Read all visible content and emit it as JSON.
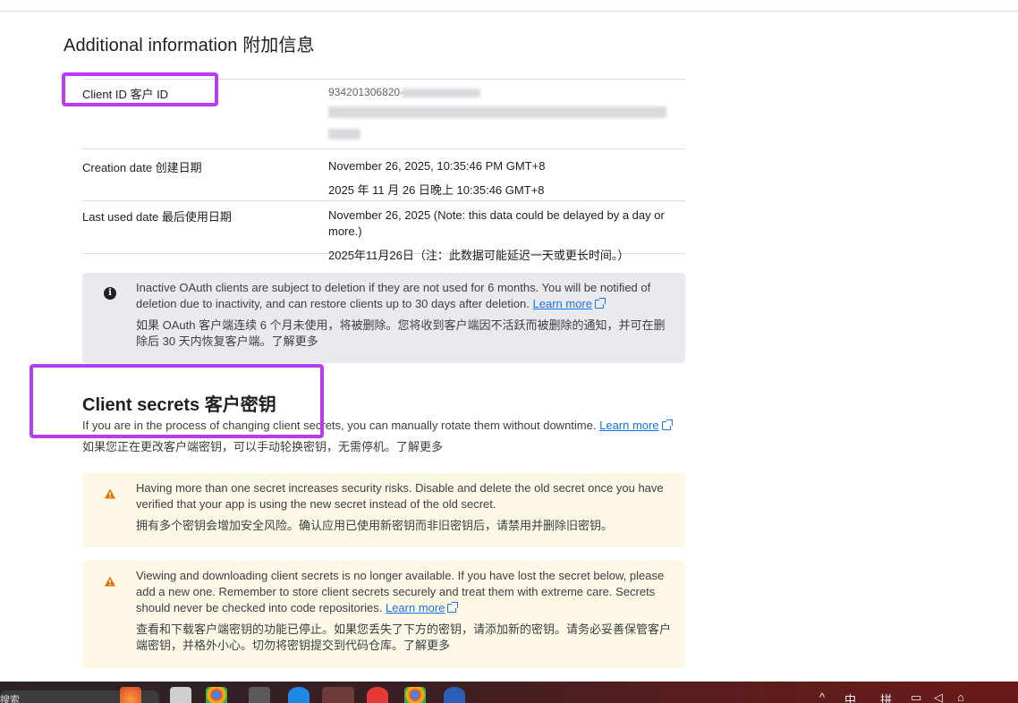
{
  "section_title": "Additional information  附加信息",
  "info_rows": {
    "client_id": {
      "label": "Client ID  客户 ID",
      "value_prefix": "934201306820-"
    },
    "creation_date": {
      "label": "Creation date  创建日期",
      "value_en": "November 26, 2025, 10:35:46 PM GMT+8",
      "value_zh": "2025 年 11 月 26 日晚上 10:35:46 GMT+8"
    },
    "last_used_date": {
      "label": "Last used date  最后使用日期",
      "value_en": "November 26, 2025 (Note: this data could be delayed by a day or more.)",
      "value_zh": "2025年11月26日（注：此数据可能延迟一天或更长时间。）"
    }
  },
  "inactive_notice": {
    "icon": "info-icon",
    "text_en": "Inactive OAuth clients are subject to deletion if they are not used for 6 months. You will be notified of deletion due to inactivity, and can restore clients up to 30 days after deletion.",
    "link": "Learn more",
    "text_zh": "如果 OAuth 客户端连续 6 个月未使用，将被删除。您将收到客户端因不活跃而被删除的通知，并可在删除后 30 天内恢复客户端。了解更多"
  },
  "client_secrets": {
    "title": "Client secrets  客户密钥",
    "desc_en": "If you are in the process of changing client secrets, you can manually rotate them without downtime.",
    "link": "Learn more",
    "desc_zh": "如果您正在更改客户端密钥，可以手动轮换密钥，无需停机。了解更多"
  },
  "warning_multiple": {
    "icon": "warning-icon",
    "text_en": "Having more than one secret increases security risks. Disable and delete the old secret once you have verified that your app is using the new secret instead of the old secret.",
    "text_zh": "拥有多个密钥会增加安全风险。确认应用已使用新密钥而非旧密钥后，请禁用并删除旧密钥。"
  },
  "warning_download": {
    "icon": "warning-icon",
    "text_en": "Viewing and downloading client secrets is no longer available. If you have lost the secret below, please add a new one. Remember to store client secrets securely and treat them with extreme care. Secrets should never be checked into code repositories.",
    "link": "Learn more",
    "text_zh": "查看和下载客户端密钥的功能已停止。如果您丢失了下方的密钥，请添加新的密钥。请务必妥善保管客户端密钥，并格外小心。切勿将密钥提交到代码仓库。了解更多"
  },
  "taskbar": {
    "search_label": "搜索",
    "tray": [
      "^",
      "中",
      "拼"
    ]
  },
  "colors": {
    "highlight": "#b83cf2",
    "link": "#1a73e8",
    "info_bg": "#e9eaee",
    "warn_bg": "#fdf8e5",
    "warn_icon": "#e37400"
  }
}
